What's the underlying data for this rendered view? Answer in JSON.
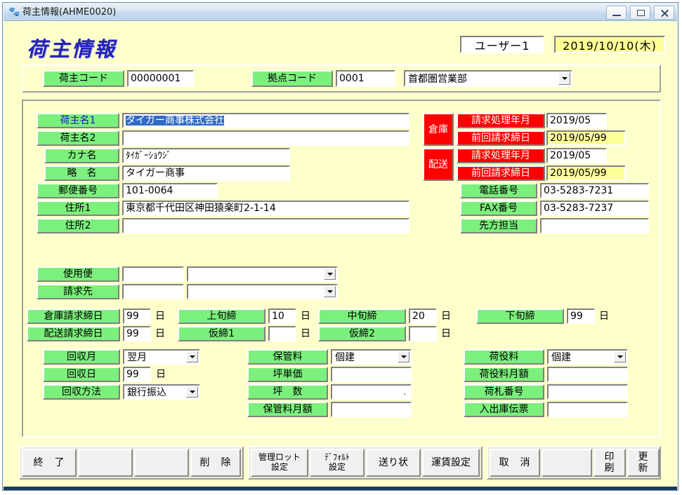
{
  "window": {
    "title": "荷主情報(AHME0020)",
    "icon": "app-icon",
    "buttons": {
      "minimize": "minimize-icon",
      "maximize": "maximize-icon",
      "close": "close-icon"
    }
  },
  "header": {
    "heading": "荷主情報",
    "user": "ユーザー1",
    "date": "2019/10/10(木)"
  },
  "code_row": {
    "shipper_code_label": "荷主コード",
    "shipper_code_value": "00000001",
    "base_code_label": "拠点コード",
    "base_code_value": "0001",
    "base_name_value": "首都圏営業部"
  },
  "left_fields": [
    {
      "label": "荷主名1",
      "value": "タイガー商事株式会社",
      "selected": true
    },
    {
      "label": "荷主名2",
      "value": ""
    },
    {
      "label": "カナ名",
      "value": "ﾀｲｶﾞｰｼｮｳｼﾞ"
    },
    {
      "label": "略　名",
      "value": "タイガー商事"
    },
    {
      "label": "郵便番号",
      "value": "101-0064"
    },
    {
      "label": "住所1",
      "value": "東京都千代田区神田猿楽町2-1-14"
    },
    {
      "label": "住所2",
      "value": ""
    }
  ],
  "billing_blocks": [
    {
      "category": "倉庫",
      "rows": [
        {
          "label": "請求処理年月",
          "value": "2019/05",
          "highlight": false
        },
        {
          "label": "前回請求締日",
          "value": "2019/05/99",
          "highlight": true
        }
      ]
    },
    {
      "category": "配送",
      "rows": [
        {
          "label": "請求処理年月",
          "value": "2019/05",
          "highlight": false
        },
        {
          "label": "前回請求締日",
          "value": "2019/05/99",
          "highlight": true
        }
      ]
    }
  ],
  "contact_fields": [
    {
      "label": "電話番号",
      "value": "03-5283-7231"
    },
    {
      "label": "FAX番号",
      "value": "03-5283-7237"
    },
    {
      "label": "先方担当",
      "value": ""
    }
  ],
  "combo_rows": [
    {
      "label": "使用便",
      "code": "",
      "name": ""
    },
    {
      "label": "請求先",
      "code": "",
      "name": ""
    }
  ],
  "closing_rows": [
    {
      "label": "倉庫請求締日",
      "value": "99",
      "unit": "日"
    },
    {
      "label": "上旬締",
      "value": "10",
      "unit": "日"
    },
    {
      "label": "中旬締",
      "value": "20",
      "unit": "日"
    },
    {
      "label": "下旬締",
      "value": "99",
      "unit": "日"
    },
    {
      "label": "配送請求締日",
      "value": "99",
      "unit": "日"
    },
    {
      "label": "仮締1",
      "value": "",
      "unit": "日"
    },
    {
      "label": "仮締2",
      "value": "",
      "unit": "日"
    }
  ],
  "collect_block": [
    {
      "label": "回収月",
      "value": "翌月",
      "type": "combo"
    },
    {
      "label": "回収日",
      "value": "99",
      "unit": "日",
      "type": "text"
    },
    {
      "label": "回収方法",
      "value": "銀行振込",
      "type": "combo"
    }
  ],
  "storage_block": [
    {
      "label": "保管料",
      "value": "個建",
      "type": "combo"
    },
    {
      "label": "坪単価",
      "value": "",
      "type": "text"
    },
    {
      "label": "坪　数",
      "value": "",
      "type": "text",
      "suffix": "."
    },
    {
      "label": "保管料月額",
      "value": "",
      "type": "text"
    }
  ],
  "handling_block": [
    {
      "label": "荷役料",
      "value": "個建",
      "type": "combo"
    },
    {
      "label": "荷役料月額",
      "value": "",
      "type": "text"
    },
    {
      "label": "荷札番号",
      "value": "",
      "type": "text"
    },
    {
      "label": "入出庫伝票",
      "value": "",
      "type": "text"
    }
  ],
  "buttons": {
    "group1": [
      {
        "label": "終　了",
        "disabled": true
      },
      {
        "label": "",
        "disabled": false
      },
      {
        "label": "",
        "disabled": false
      },
      {
        "label": "削　除",
        "disabled": false
      }
    ],
    "group2": [
      {
        "label": "管理ロット\n設定",
        "disabled": false
      },
      {
        "label": "ﾃﾞﾌｫﾙﾄ\n設定",
        "disabled": false
      },
      {
        "label": "送り状",
        "disabled": false
      },
      {
        "label": "運賃設定",
        "disabled": false
      }
    ],
    "group3": [
      {
        "label": "取　消",
        "disabled": false
      },
      {
        "label": "",
        "disabled": false
      },
      {
        "label": "印　刷",
        "disabled": true
      },
      {
        "label": "更　新",
        "disabled": false
      }
    ]
  },
  "colors": {
    "label_green": "#7cf07c",
    "label_red": "#ff0000",
    "client_bg": "#ffffcc",
    "highlight_yellow": "#ffff99",
    "selection_blue": "#316ac5",
    "heading_blue": "#2222bb"
  }
}
